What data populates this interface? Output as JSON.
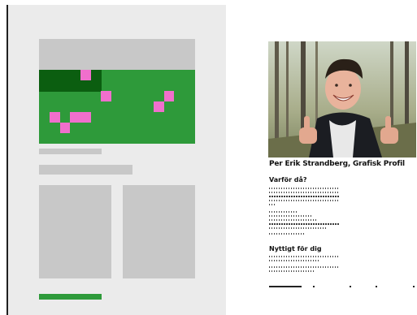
{
  "profile": {
    "title": "Per Erik Strandberg, Grafisk Profil",
    "why_heading": "Varför då?",
    "useful_heading": "Nyttigt för dig"
  },
  "mockup": {
    "colors": {
      "page": "#ebebeb",
      "placeholder": "#c8c8c8",
      "green": "#2e9a3a",
      "dark_green": "#0b5e10",
      "pink": "#f06fcc"
    }
  },
  "photo": {
    "subject": "smiling man giving two thumbs up in a forest"
  }
}
